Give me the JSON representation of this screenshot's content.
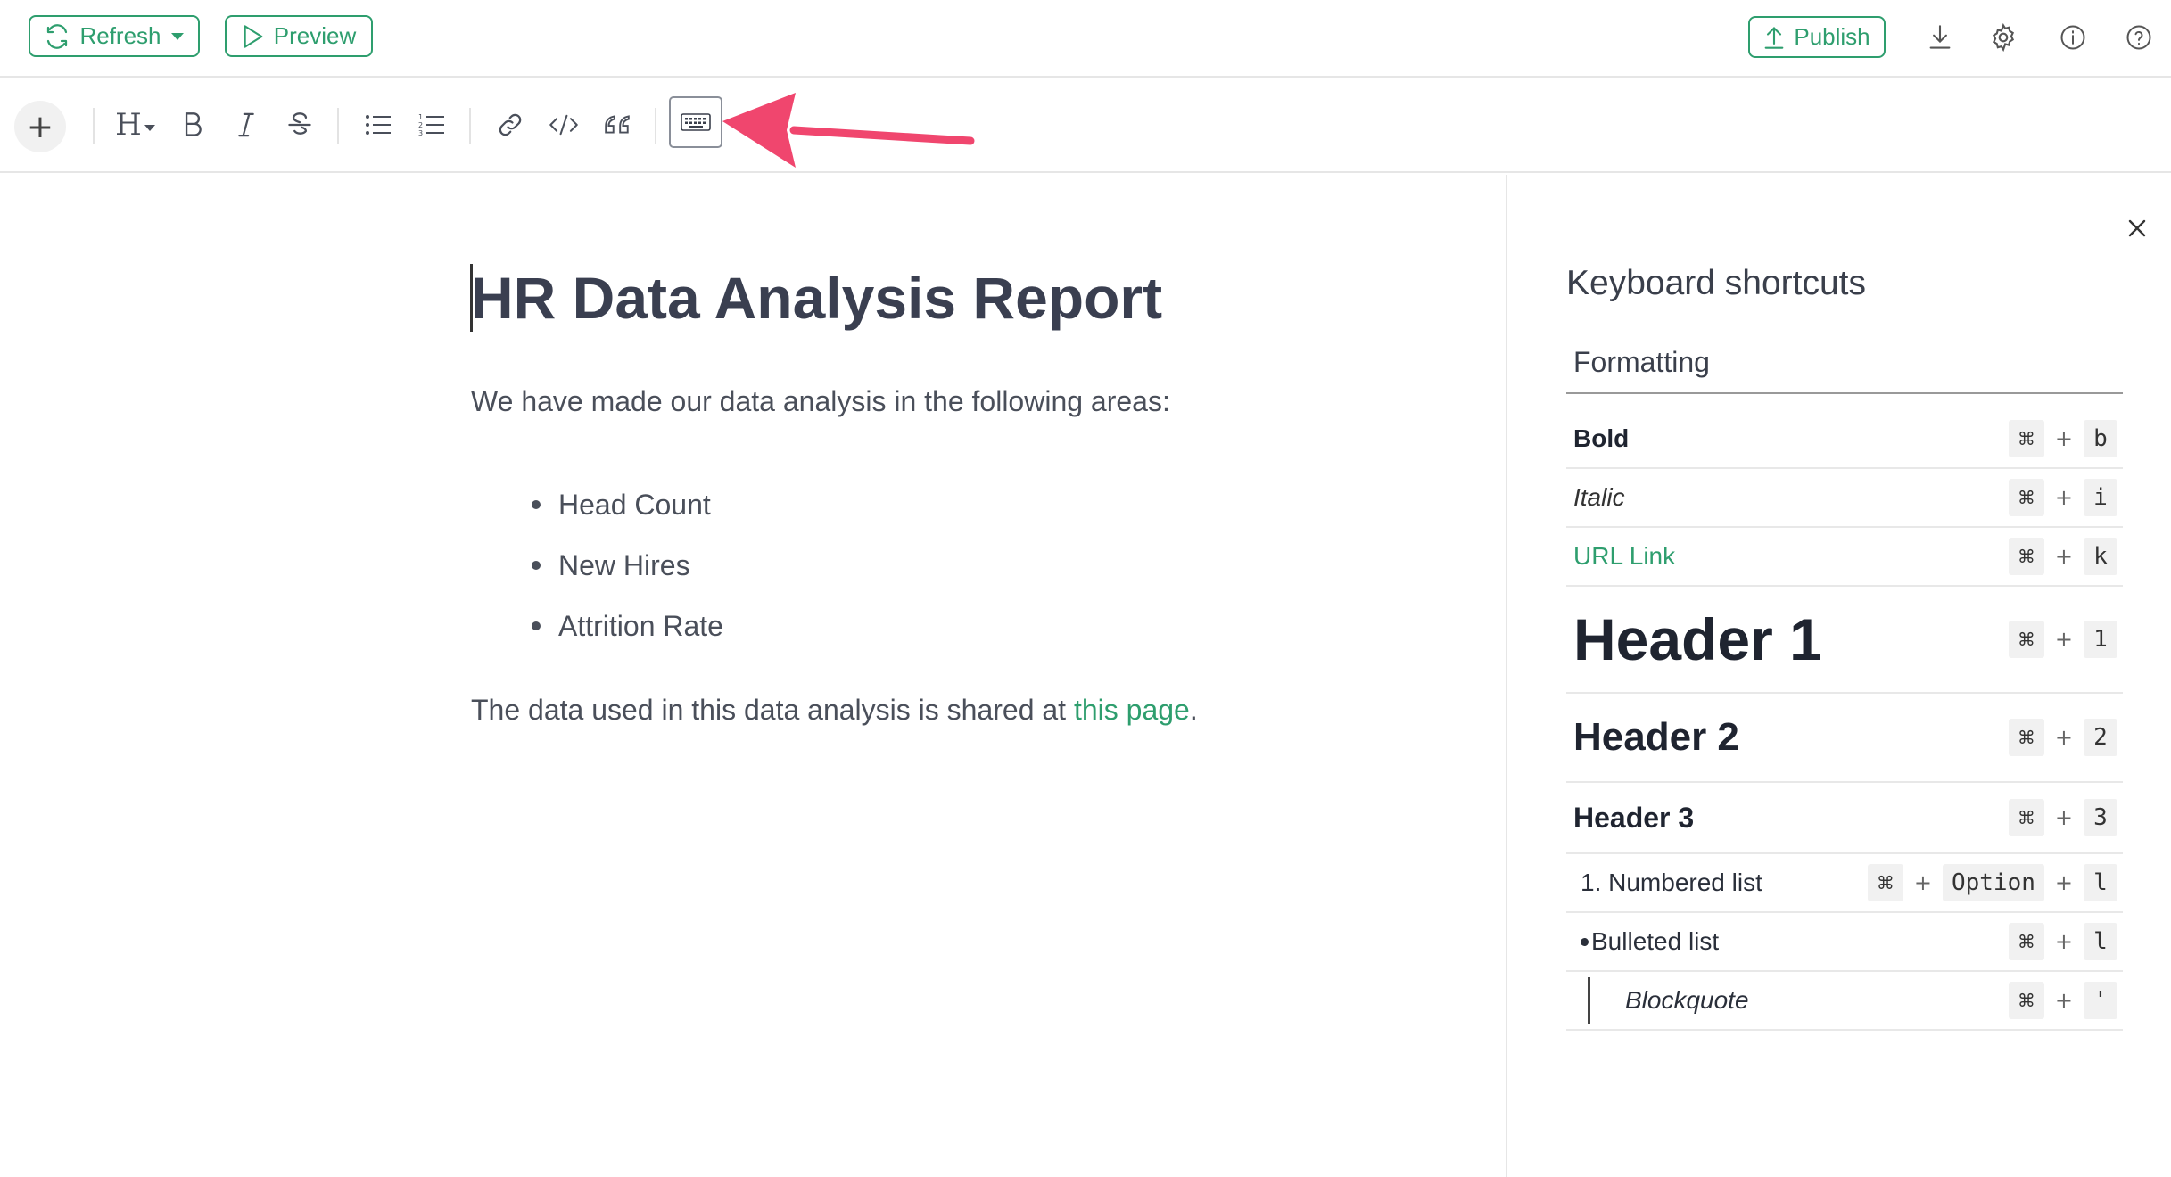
{
  "topbar": {
    "refresh_label": "Refresh",
    "preview_label": "Preview",
    "publish_label": "Publish",
    "icons": [
      "download-icon",
      "gear-icon",
      "info-icon",
      "help-icon"
    ]
  },
  "toolbar": {
    "add_label": "+",
    "heading_label": "H",
    "icons": [
      "bold-icon",
      "italic-icon",
      "strikethrough-icon",
      "bulleted-list-icon",
      "numbered-list-icon",
      "link-icon",
      "code-icon",
      "quote-icon",
      "keyboard-icon"
    ]
  },
  "document": {
    "title": "HR Data Analysis Report",
    "intro": "We have made our data analysis in the following areas:",
    "list": [
      "Head Count",
      "New Hires",
      "Attrition Rate"
    ],
    "footer_prefix": "The data used in this data analysis is shared at ",
    "footer_link": "this page",
    "footer_suffix": "."
  },
  "shortcuts_panel": {
    "title": "Keyboard shortcuts",
    "section": "Formatting",
    "close_label": "×",
    "plus": "+",
    "rows": [
      {
        "label": "Bold",
        "keys": [
          "⌘",
          "b"
        ]
      },
      {
        "label": "Italic",
        "keys": [
          "⌘",
          "i"
        ]
      },
      {
        "label": "URL Link",
        "keys": [
          "⌘",
          "k"
        ]
      },
      {
        "label": "Header 1",
        "keys": [
          "⌘",
          "1"
        ]
      },
      {
        "label": "Header 2",
        "keys": [
          "⌘",
          "2"
        ]
      },
      {
        "label": "Header 3",
        "keys": [
          "⌘",
          "3"
        ]
      },
      {
        "label": "1. Numbered list",
        "keys": [
          "⌘",
          "Option",
          "l"
        ]
      },
      {
        "label": "Bulleted list",
        "keys": [
          "⌘",
          "l"
        ]
      },
      {
        "label": "Blockquote",
        "keys": [
          "⌘",
          "'"
        ]
      }
    ]
  },
  "colors": {
    "accent": "#2e9e6e",
    "annotation_arrow": "#f0466e",
    "text": "#3a3f4b"
  }
}
